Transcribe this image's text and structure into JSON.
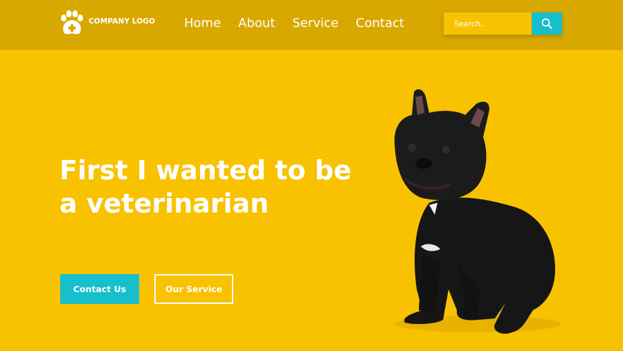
{
  "header": {
    "logo_text": "COMPANY LOGO",
    "logo_icon": "paw-plus-icon",
    "nav": [
      {
        "label": "Home"
      },
      {
        "label": "About"
      },
      {
        "label": "Service"
      },
      {
        "label": "Contact"
      }
    ],
    "search": {
      "placeholder": "Search..",
      "icon": "search-icon"
    }
  },
  "hero": {
    "title": "First I wanted to be a veterinarian",
    "primary_button": "Contact Us",
    "secondary_button": "Our Service",
    "image": "french-bulldog-photo"
  },
  "colors": {
    "background": "#f8c200",
    "header": "#d8a800",
    "accent": "#17bfcc",
    "text": "#ffffff"
  }
}
